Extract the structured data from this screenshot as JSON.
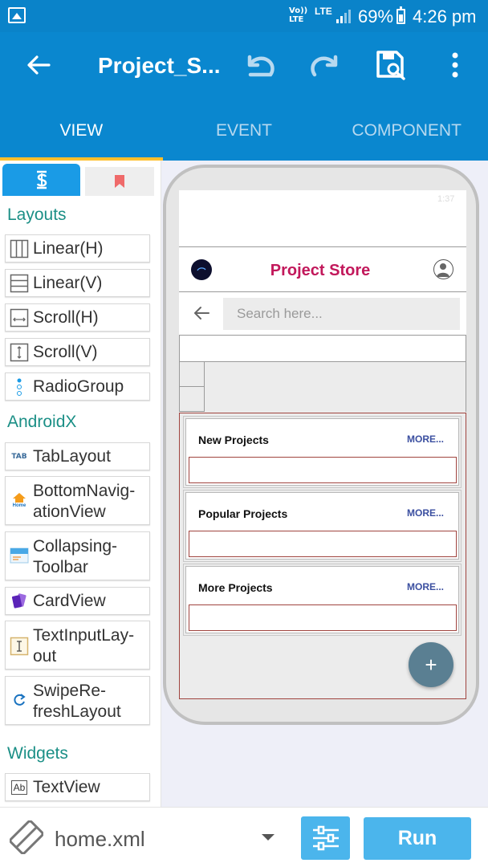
{
  "status_bar": {
    "network_label": "Vo)) LTE",
    "lte_label": "LTE",
    "battery_percent": "69%",
    "time": "4:26 pm"
  },
  "app_bar": {
    "title": "Project_S...",
    "tabs": [
      {
        "label": "VIEW",
        "active": true
      },
      {
        "label": "EVENT",
        "active": false
      },
      {
        "label": "COMPONENT",
        "active": false
      }
    ]
  },
  "palette": {
    "sections": {
      "layouts": "Layouts",
      "androidx": "AndroidX",
      "widgets": "Widgets"
    },
    "layouts": [
      "Linear(H)",
      "Linear(V)",
      "Scroll(H)",
      "Scroll(V)",
      "RadioGroup"
    ],
    "androidx": {
      "tab_layout": "TabLayout",
      "bottom_nav_line1": "BottomNavig-",
      "bottom_nav_line2": "ationView",
      "collapsing_line1": "Collapsing-",
      "collapsing_line2": "Toolbar",
      "card_view": "CardView",
      "text_input_line1": "TextInputLay-",
      "text_input_line2": "out",
      "swipe_line1": "SwipeRe-",
      "swipe_line2": "freshLayout"
    },
    "widgets": [
      "TextView"
    ],
    "icon_labels": {
      "tab": "TAB",
      "home": "Home",
      "text": "Ab"
    }
  },
  "preview": {
    "status_text": "1:37",
    "store_title": "Project Store",
    "search_placeholder": "Search here...",
    "cards": [
      {
        "title": "New Projects",
        "more": "MORE..."
      },
      {
        "title": "Popular Projects",
        "more": "MORE..."
      },
      {
        "title": "More Projects",
        "more": "MORE..."
      }
    ],
    "fab_label": "+",
    "colors": {
      "title": "#c2185b",
      "more": "#3b4fa0",
      "fab": "#5a7f92"
    }
  },
  "bottom_bar": {
    "file_name": "home.xml",
    "run_label": "Run"
  }
}
